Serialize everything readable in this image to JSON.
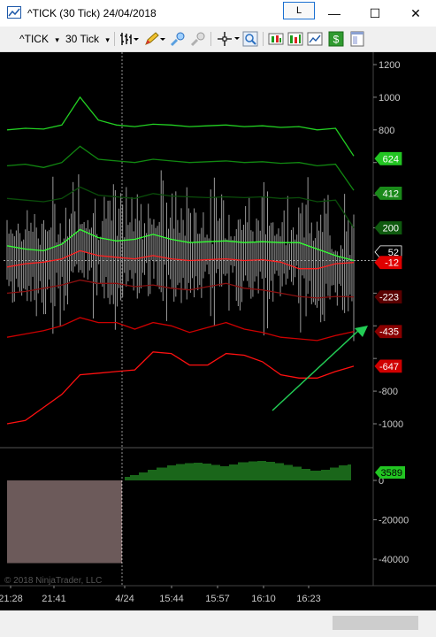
{
  "window": {
    "title": "^TICK (30 Tick)  24/04/2018",
    "l_button": "L",
    "minimize": "—",
    "maximize": "☐",
    "close": "✕"
  },
  "toolbar": {
    "instrument": "^TICK",
    "interval": "30 Tick",
    "dropdown_glyph": "▾"
  },
  "chart_data": [
    {
      "type": "line",
      "panel": "price",
      "description_source": "candlestick TICK chart with envelope bands",
      "ylim": [
        -1200,
        1300
      ],
      "y_ticks": [
        1200,
        1000,
        800,
        600,
        400,
        200,
        0,
        -200,
        -400,
        -600,
        -800,
        -1000
      ],
      "y_tick_labels": [
        "1200",
        "1000",
        "800",
        "",
        "",
        "",
        "",
        "",
        "",
        "",
        "-800",
        "-1000"
      ],
      "x_tick_labels": [
        "21:28",
        "21:41",
        "4/24",
        "15:44",
        "15:57",
        "16:10",
        "16:23"
      ],
      "value_tags": [
        {
          "label": "624",
          "value": 624,
          "color": "#22c522"
        },
        {
          "label": "412",
          "value": 412,
          "color": "#1a8a1a"
        },
        {
          "label": "200",
          "value": 200,
          "color": "#0f5a0f"
        },
        {
          "label": "52",
          "value": 52,
          "color": "#000000"
        },
        {
          "label": "-12",
          "value": -12,
          "color": "#e00000"
        },
        {
          "label": "-223",
          "value": -223,
          "color": "#5a0000"
        },
        {
          "label": "-435",
          "value": -435,
          "color": "#8a0000"
        },
        {
          "label": "-647",
          "value": -647,
          "color": "#d00000"
        }
      ],
      "series": [
        {
          "color": "#22d022",
          "values": [
            800,
            810,
            805,
            830,
            1000,
            860,
            830,
            820,
            835,
            830,
            820,
            825,
            830,
            820,
            825,
            815,
            820,
            800,
            810,
            640
          ]
        },
        {
          "color": "#118811",
          "values": [
            580,
            590,
            570,
            600,
            700,
            620,
            610,
            600,
            620,
            610,
            600,
            605,
            610,
            600,
            605,
            595,
            600,
            580,
            590,
            430
          ]
        },
        {
          "color": "#0a4d0a",
          "values": [
            380,
            370,
            360,
            380,
            450,
            400,
            390,
            380,
            410,
            395,
            390,
            385,
            390,
            385,
            390,
            380,
            385,
            360,
            370,
            200
          ]
        },
        {
          "color": "#33ff33",
          "values": [
            90,
            70,
            60,
            100,
            190,
            140,
            120,
            130,
            160,
            130,
            110,
            115,
            120,
            110,
            115,
            110,
            110,
            70,
            30,
            0
          ]
        },
        {
          "color": "#ff2020",
          "values": [
            -40,
            -20,
            -10,
            10,
            60,
            30,
            20,
            10,
            30,
            10,
            0,
            5,
            10,
            0,
            5,
            -10,
            -50,
            -50,
            -20,
            -12
          ]
        },
        {
          "color": "#8a1010",
          "values": [
            -200,
            -190,
            -170,
            -150,
            -120,
            -140,
            -140,
            -160,
            -150,
            -170,
            -180,
            -160,
            -140,
            -170,
            -180,
            -200,
            -220,
            -230,
            -220,
            -223
          ]
        },
        {
          "color": "#cc0000",
          "values": [
            -470,
            -450,
            -430,
            -400,
            -350,
            -380,
            -380,
            -420,
            -380,
            -400,
            -440,
            -410,
            -380,
            -420,
            -440,
            -470,
            -480,
            -490,
            -460,
            -435
          ]
        },
        {
          "color": "#ff1010",
          "values": [
            -1000,
            -980,
            -900,
            -820,
            -700,
            -690,
            -680,
            -670,
            -560,
            -570,
            -640,
            -640,
            -570,
            -580,
            -620,
            -700,
            -720,
            -720,
            -680,
            -647
          ]
        }
      ]
    },
    {
      "type": "bar",
      "panel": "indicator",
      "ylim": [
        -45000,
        5000
      ],
      "y_ticks": [
        0,
        -20000,
        -40000
      ],
      "y_tick_labels": [
        "0",
        "-20000",
        "-40000"
      ],
      "current_value_label": "3589",
      "current_value": 3589,
      "segments": [
        {
          "from_bar": 0,
          "to_bar": 56,
          "value": -42000,
          "color": "#d9b3b3"
        },
        {
          "from_bar": 57,
          "to_bar": 160,
          "profile": [
            800,
            1200,
            1800,
            2400,
            2900,
            3400,
            3700,
            3900,
            4000,
            3800,
            3500,
            3200,
            3600,
            4100,
            4300,
            4400,
            4200,
            3900,
            3500,
            3100,
            2600,
            2200,
            2400,
            2900,
            3400,
            3589
          ],
          "color": "#33cc33"
        }
      ]
    }
  ],
  "watermark": "© 2018 NinjaTrader, LLC",
  "colors": {
    "background": "#000000",
    "axis_text": "#c8c8c8",
    "candles": "#9a9a9a",
    "arrow": "#22cc55"
  },
  "icons": [
    "chart-window-icon",
    "bar-type-icon",
    "pencil-icon",
    "zoom-icon",
    "crosshair-icon",
    "magnifier-icon",
    "strategy-icon",
    "indicator-icon",
    "chart-trader-icon",
    "dollar-icon",
    "properties-icon"
  ]
}
